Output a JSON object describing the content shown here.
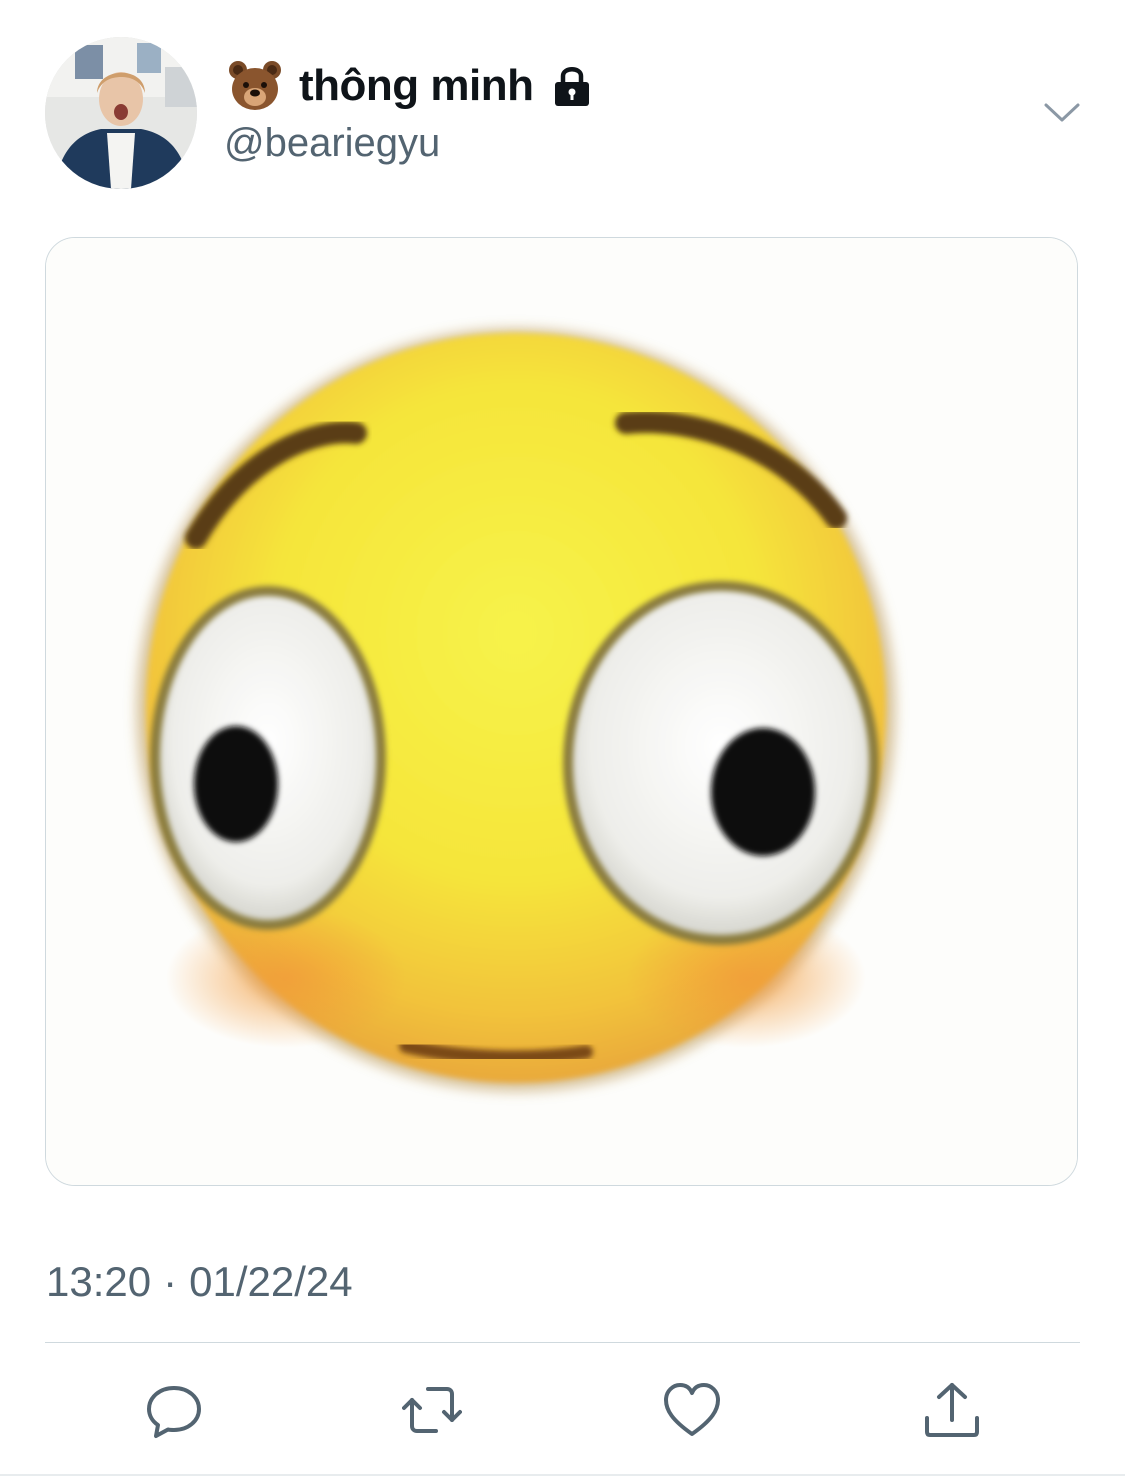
{
  "tweet": {
    "display_name": "thông minh",
    "handle": "@beariegyu",
    "timestamp_time": "13:20",
    "timestamp_separator": "·",
    "timestamp_date": "01/22/24"
  },
  "icons": {
    "name_prefix": "bear-emoji",
    "protected": "lock-icon",
    "menu": "chevron-down-icon",
    "actions": [
      "reply-icon",
      "retweet-icon",
      "like-icon",
      "share-icon"
    ]
  },
  "colors": {
    "primary_text": "#0f1419",
    "secondary_text": "#536471",
    "divider": "#cfd9de"
  }
}
